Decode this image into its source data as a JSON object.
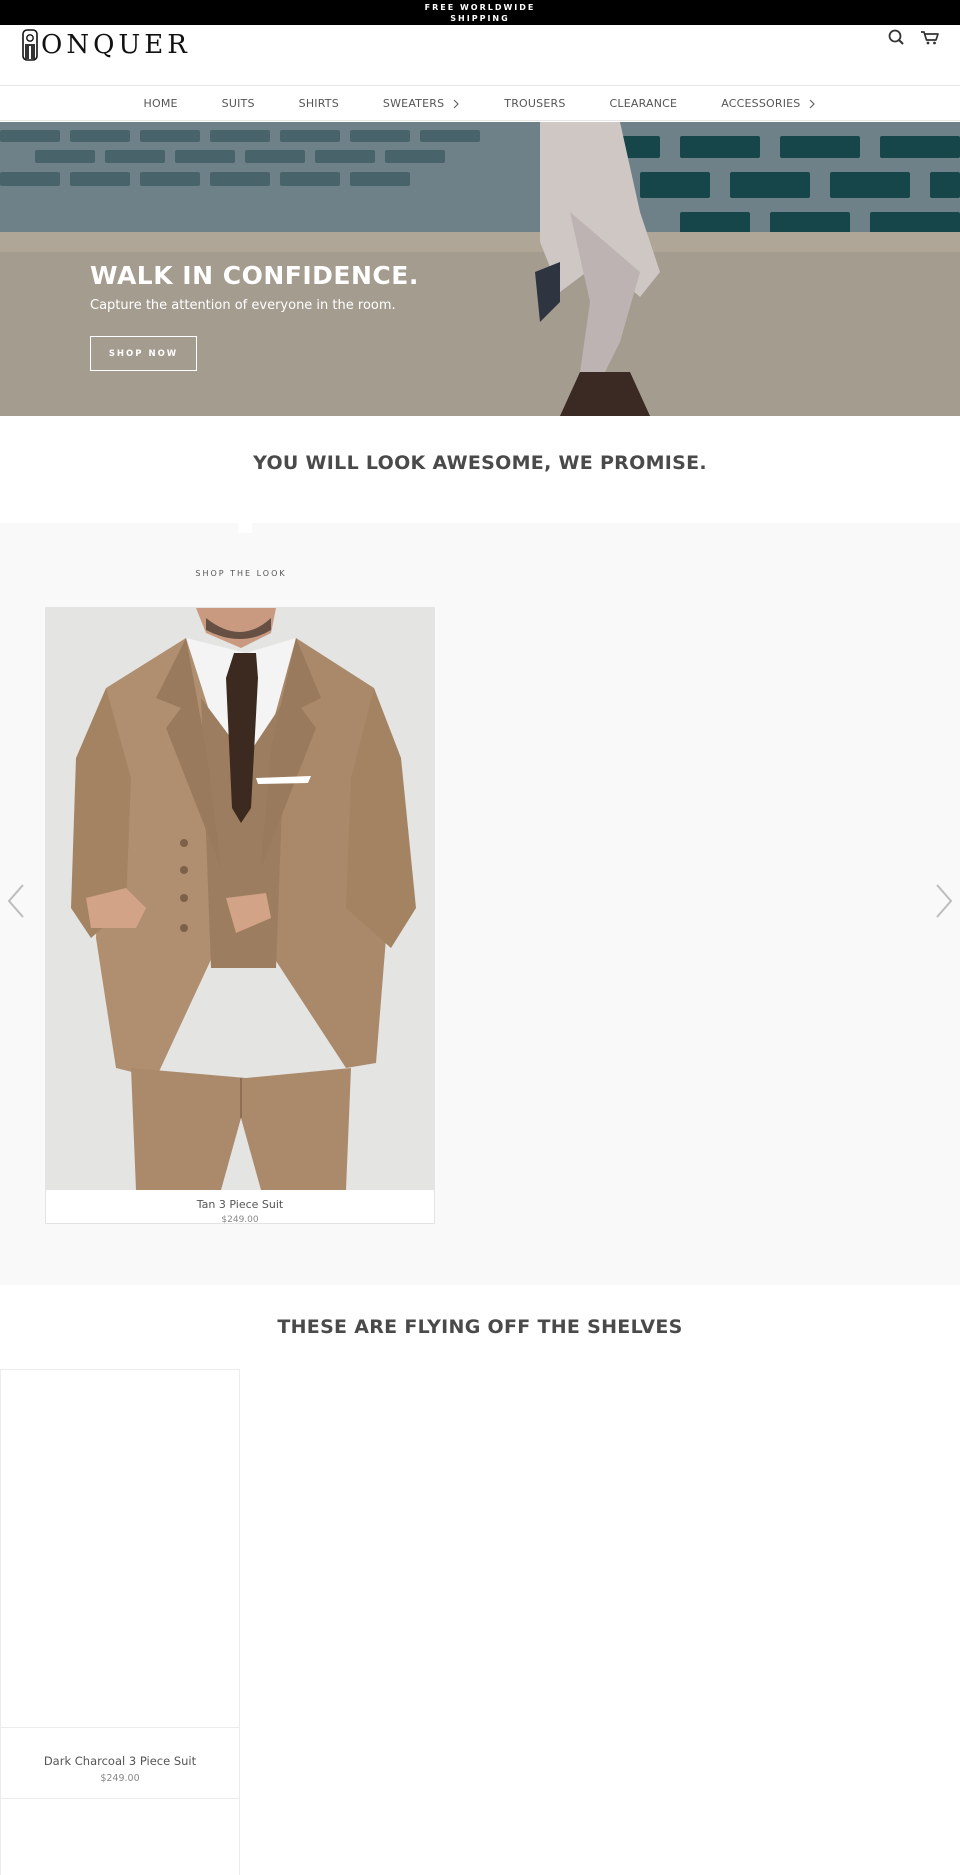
{
  "announcement": {
    "line1": "FREE WORLDWIDE",
    "line2": "SHIPPING"
  },
  "header": {
    "logo_text": "ONQUER",
    "icons": [
      "search-icon",
      "cart-icon"
    ]
  },
  "nav": {
    "items": [
      {
        "label": "HOME",
        "has_submenu": false
      },
      {
        "label": "SUITS",
        "has_submenu": false
      },
      {
        "label": "SHIRTS",
        "has_submenu": false
      },
      {
        "label": "SWEATERS",
        "has_submenu": true
      },
      {
        "label": "TROUSERS",
        "has_submenu": false
      },
      {
        "label": "CLEARANCE",
        "has_submenu": false
      },
      {
        "label": "ACCESSORIES",
        "has_submenu": true
      }
    ]
  },
  "hero": {
    "title": "WALK IN CONFIDENCE.",
    "subtitle": "Capture the attention of everyone in the room.",
    "button_label": "SHOP NOW"
  },
  "promise": {
    "heading": "YOU WILL LOOK AWESOME, WE PROMISE."
  },
  "shop_the_look": {
    "label": "SHOP THE LOOK",
    "product": {
      "name": "Tan 3 Piece Suit",
      "price": "$249.00"
    },
    "arrows": [
      "chevron-left-icon",
      "chevron-right-icon"
    ]
  },
  "shelves": {
    "heading": "THESE ARE FLYING OFF THE SHELVES",
    "products": [
      {
        "name": "Dark Charcoal 3 Piece Suit",
        "price": "$249.00"
      }
    ]
  },
  "colors": {
    "announcement_bg": "#000000",
    "text": "#4a4a4a",
    "section_bg": "#f9f9f9",
    "suit": "#b08f70"
  }
}
